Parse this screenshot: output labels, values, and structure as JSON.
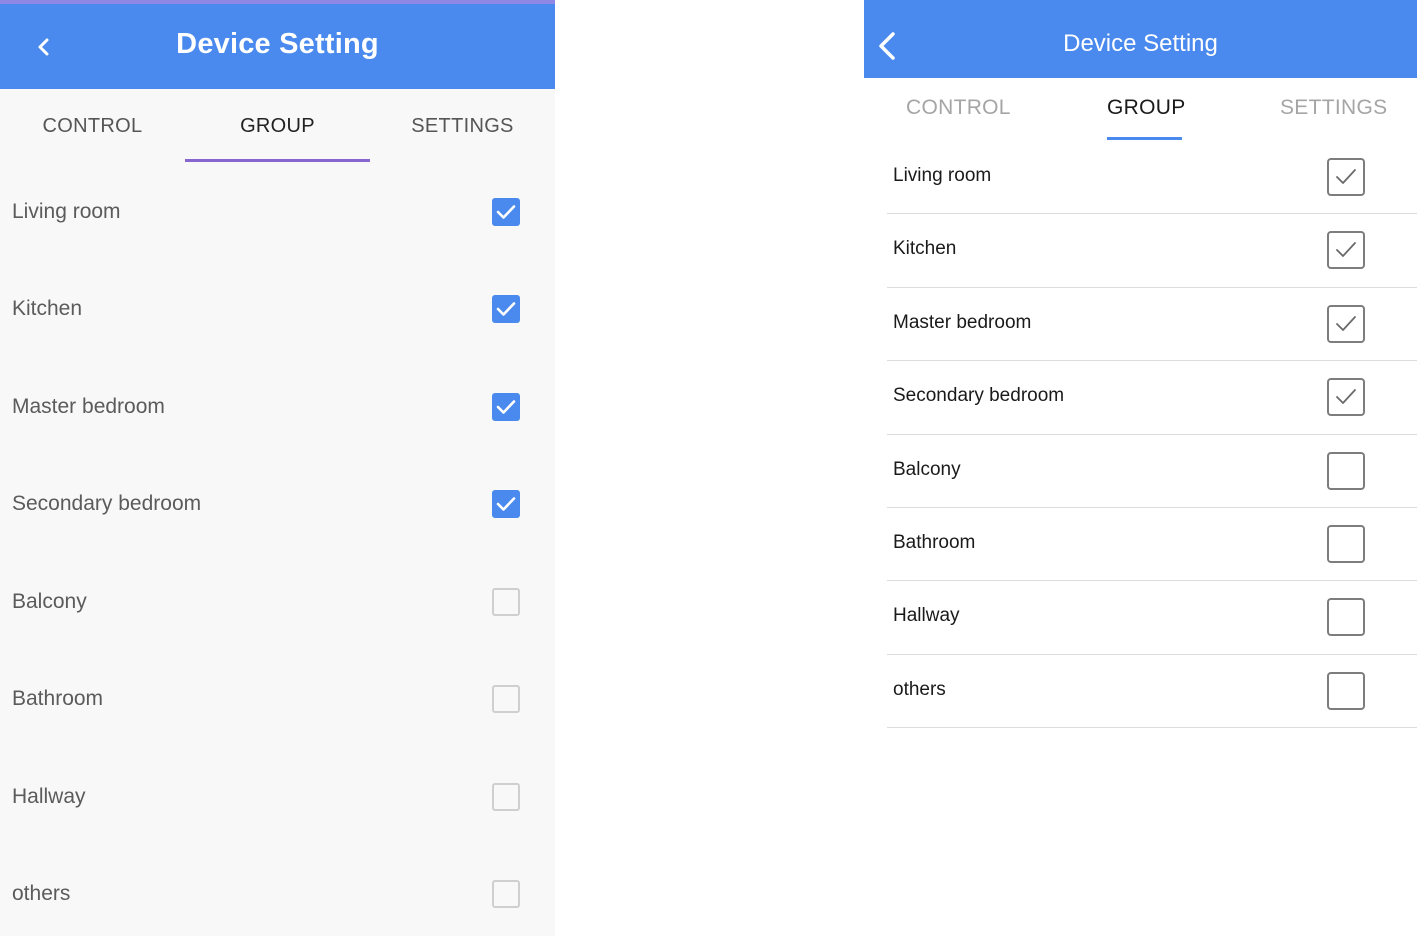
{
  "android": {
    "title": "Device Setting",
    "tabs": [
      {
        "label": "CONTROL",
        "active": false
      },
      {
        "label": "GROUP",
        "active": true
      },
      {
        "label": "SETTINGS",
        "active": false
      }
    ],
    "rooms": [
      {
        "label": "Living room",
        "checked": true
      },
      {
        "label": "Kitchen",
        "checked": true
      },
      {
        "label": "Master bedroom",
        "checked": true
      },
      {
        "label": "Secondary bedroom",
        "checked": true
      },
      {
        "label": "Balcony",
        "checked": false
      },
      {
        "label": "Bathroom",
        "checked": false
      },
      {
        "label": "Hallway",
        "checked": false
      },
      {
        "label": "others",
        "checked": false
      }
    ]
  },
  "ios": {
    "title": "Device Setting",
    "tabs": [
      {
        "label": "CONTROL",
        "active": false
      },
      {
        "label": "GROUP",
        "active": true
      },
      {
        "label": "SETTINGS",
        "active": false
      }
    ],
    "rooms": [
      {
        "label": "Living room",
        "checked": true
      },
      {
        "label": "Kitchen",
        "checked": true
      },
      {
        "label": "Master bedroom",
        "checked": true
      },
      {
        "label": "Secondary bedroom",
        "checked": true
      },
      {
        "label": "Balcony",
        "checked": false
      },
      {
        "label": "Bathroom",
        "checked": false
      },
      {
        "label": "Hallway",
        "checked": false
      },
      {
        "label": "others",
        "checked": false
      }
    ]
  },
  "icons": {
    "back": "chevron-left-icon",
    "check": "checkmark-icon"
  },
  "colors": {
    "primary": "#4a89ee",
    "android_indicator": "#8767cf",
    "ios_indicator": "#4a89ee"
  }
}
